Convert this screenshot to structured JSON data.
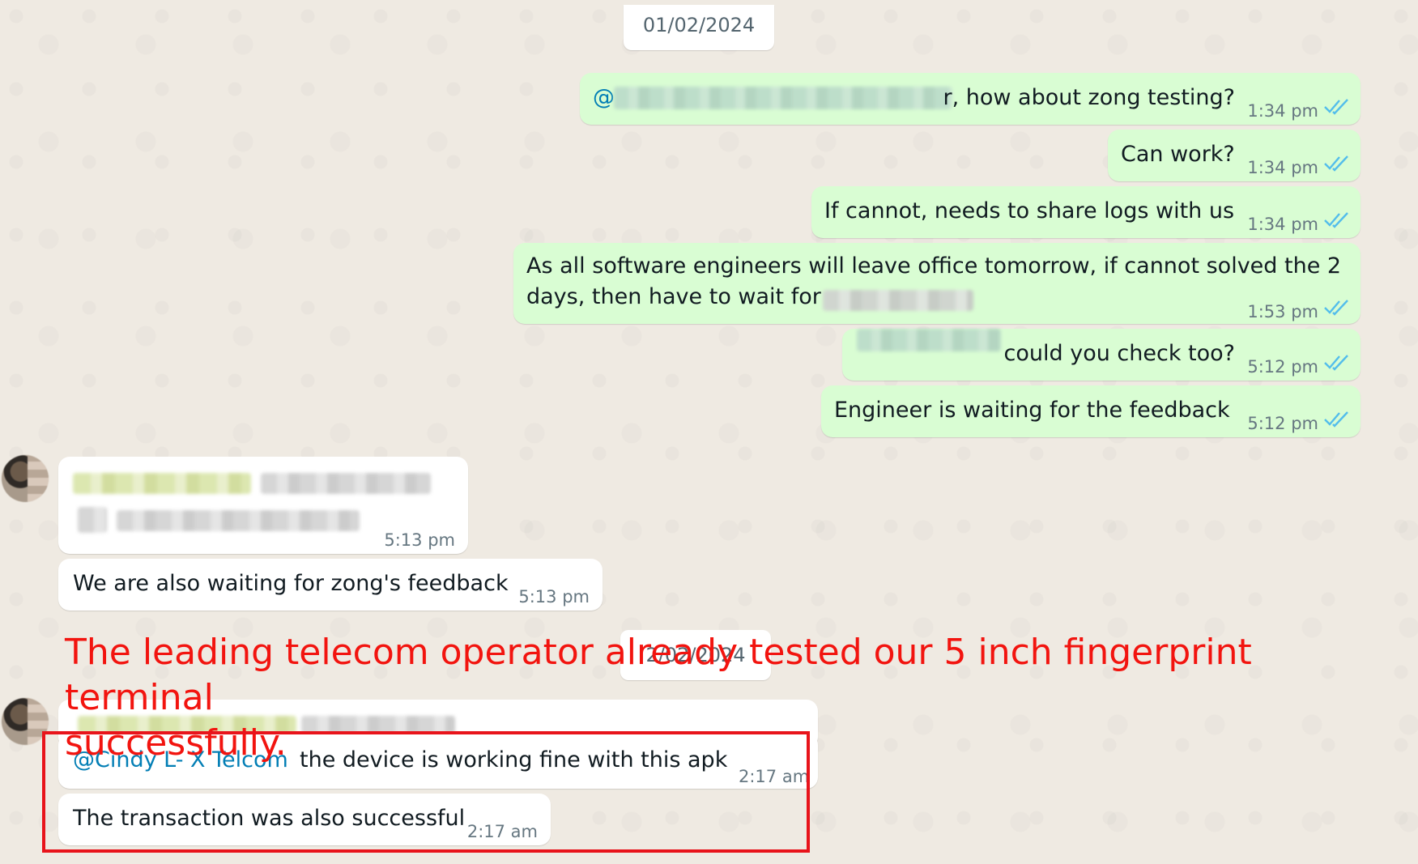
{
  "date_chips": [
    "01/02/2024",
    "2/02/2024"
  ],
  "outgoing": [
    {
      "text": "r, how about zong testing?",
      "prefix": "@",
      "time": "1:34 pm"
    },
    {
      "text": "Can work?",
      "time": "1:34 pm"
    },
    {
      "text": "If cannot, needs to share logs with us",
      "time": "1:34 pm"
    },
    {
      "line1": "As all software engineers will leave office tomorrow, if cannot solved the 2",
      "line2": "days, then have to wait for",
      "time": "1:53 pm"
    },
    {
      "text": "could you check too?",
      "time": "5:12 pm"
    },
    {
      "text": "Engineer is waiting for the feedback",
      "time": "5:12 pm"
    }
  ],
  "incoming": [
    {
      "time": "5:13 pm"
    },
    {
      "text": "We are also waiting for zong's feedback",
      "time": "5:13 pm"
    },
    {
      "mention": "@Cindy L- X Telcom",
      "text": "the device is working fine with this apk",
      "time": "2:17 am"
    },
    {
      "text": "The transaction was also successful",
      "time": "2:17 am"
    }
  ],
  "annotation": {
    "line1": "The leading telecom operator already tested our 5 inch fingerprint terminal",
    "line2": "successfully."
  },
  "colors": {
    "outgoing_bubble": "#d9fdd3",
    "incoming_bubble": "#ffffff",
    "read_ticks": "#53bdeb",
    "annotation": "#f2140f",
    "mention": "#027eb5"
  },
  "icons": {
    "read_receipt": "double-check-icon"
  }
}
